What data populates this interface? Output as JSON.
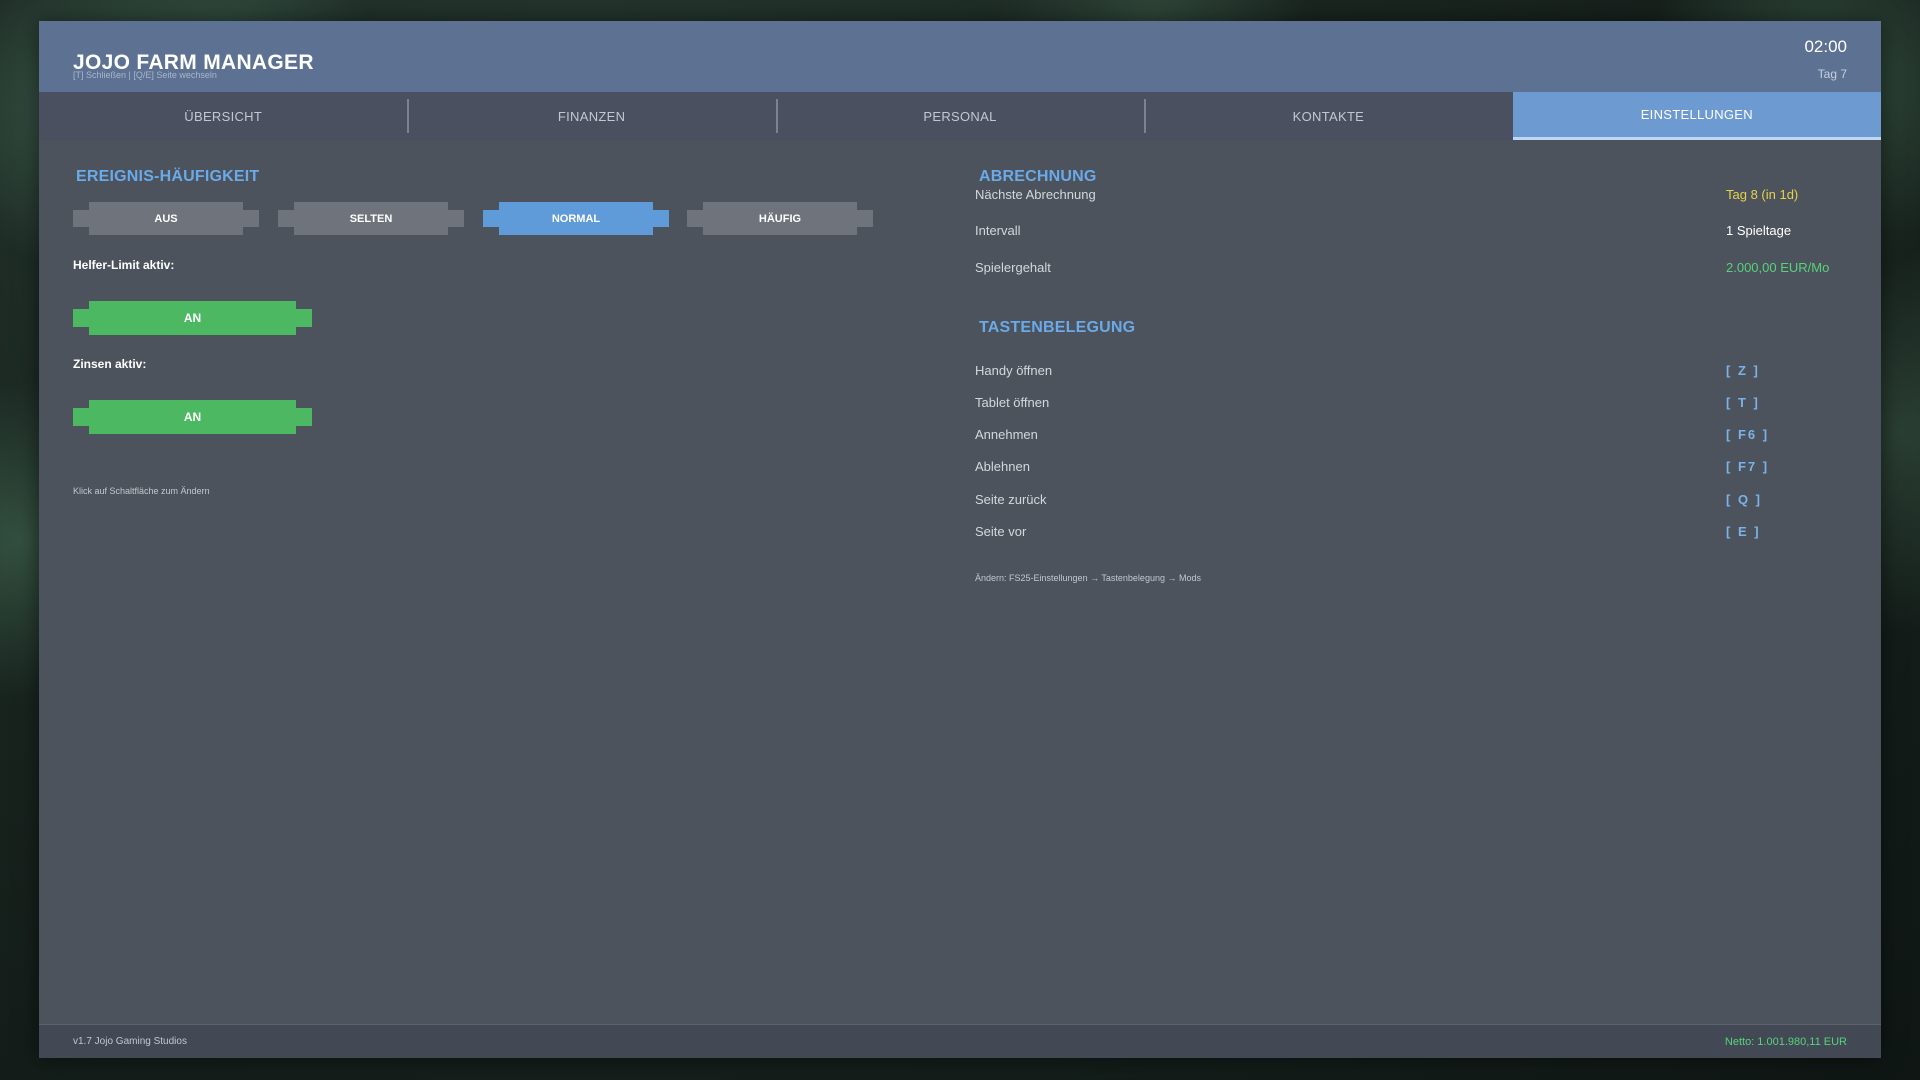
{
  "header": {
    "title": "JOJO FARM MANAGER",
    "hint": "[T] Schließen  |  [Q/E] Seite wechseln",
    "time": "02:00",
    "day": "Tag 7"
  },
  "tabs": [
    {
      "label": "ÜBERSICHT",
      "active": false
    },
    {
      "label": "FINANZEN",
      "active": false
    },
    {
      "label": "PERSONAL",
      "active": false
    },
    {
      "label": "KONTAKTE",
      "active": false
    },
    {
      "label": "EINSTELLUNGEN",
      "active": true
    }
  ],
  "event_frequency": {
    "title": "EREIGNIS-HÄUFIGKEIT",
    "options": [
      {
        "label": "AUS",
        "active": false
      },
      {
        "label": "SELTEN",
        "active": false
      },
      {
        "label": "NORMAL",
        "active": true
      },
      {
        "label": "HÄUFIG",
        "active": false
      }
    ]
  },
  "helper_limit": {
    "label": "Helfer-Limit aktiv:",
    "value": "AN"
  },
  "interest": {
    "label": "Zinsen aktiv:",
    "value": "AN"
  },
  "left_hint": "Klick auf Schaltfläche zum Ändern",
  "billing": {
    "title": "ABRECHNUNG",
    "rows": [
      {
        "label": "Nächste Abrechnung",
        "value": "Tag 8 (in 1d)",
        "color": "#e6d24a"
      },
      {
        "label": "Intervall",
        "value": "1 Spieltage",
        "color": "#ffffff"
      },
      {
        "label": "Spielergehalt",
        "value": "2.000,00 EUR/Mo",
        "color": "#56d37b"
      }
    ]
  },
  "keybindings": {
    "title": "TASTENBELEGUNG",
    "rows": [
      {
        "label": "Handy öffnen",
        "key": "[ Z ]"
      },
      {
        "label": "Tablet öffnen",
        "key": "[ T ]"
      },
      {
        "label": "Annehmen",
        "key": "[ F6 ]"
      },
      {
        "label": "Ablehnen",
        "key": "[ F7 ]"
      },
      {
        "label": "Seite zurück",
        "key": "[ Q ]"
      },
      {
        "label": "Seite vor",
        "key": "[ E ]"
      }
    ],
    "hint": "Ändern: FS25-Einstellungen → Tastenbelegung → Mods"
  },
  "footer": {
    "version": "v1.7   Jojo Gaming Studios",
    "net": "Netto: 1.001.980,11 EUR"
  },
  "colors": {
    "accent": "#6aaae8",
    "active_tab": "#6c9ad1",
    "toggle_on": "#4cb862",
    "panel": "#4d535c",
    "header": "#5d7293"
  }
}
